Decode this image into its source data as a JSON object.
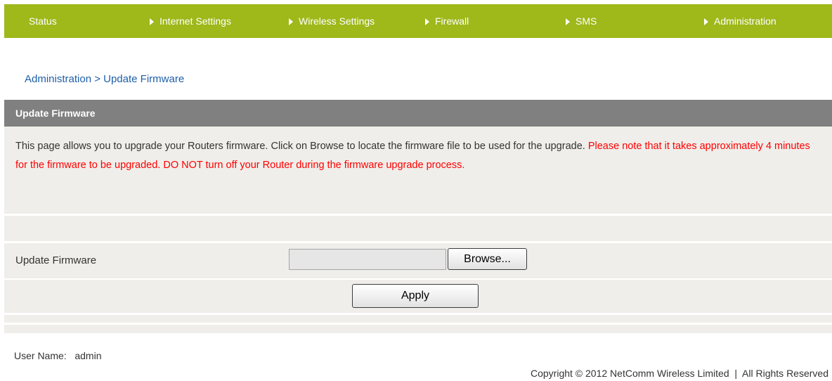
{
  "nav": {
    "items": [
      {
        "label": "Status",
        "arrow": false
      },
      {
        "label": "Internet Settings",
        "arrow": true
      },
      {
        "label": "Wireless Settings",
        "arrow": true
      },
      {
        "label": "Firewall",
        "arrow": true
      },
      {
        "label": "SMS",
        "arrow": true
      },
      {
        "label": "Administration",
        "arrow": true
      }
    ]
  },
  "breadcrumb": "Administration > Update Firmware",
  "panel": {
    "title": "Update Firmware",
    "description": "This page allows you to upgrade your Routers firmware. Click on Browse to locate the firmware file to be used for the upgrade.",
    "warning": "Please note that it takes approximately 4 minutes for the firmware to be upgraded. DO NOT turn off your Router during the firmware upgrade process."
  },
  "form": {
    "field_label": "Update Firmware",
    "file_value": "",
    "browse_label": "Browse...",
    "apply_label": "Apply"
  },
  "footer": {
    "user": "User Name:   admin",
    "copyright": "Copyright © 2012 NetComm Wireless Limited  |  All Rights Reserved"
  },
  "colors": {
    "nav_bg": "#9fb81a",
    "header_bg": "#808080",
    "panel_bg": "#efeeea",
    "warning": "#ff0000",
    "link": "#1e5fa8"
  }
}
